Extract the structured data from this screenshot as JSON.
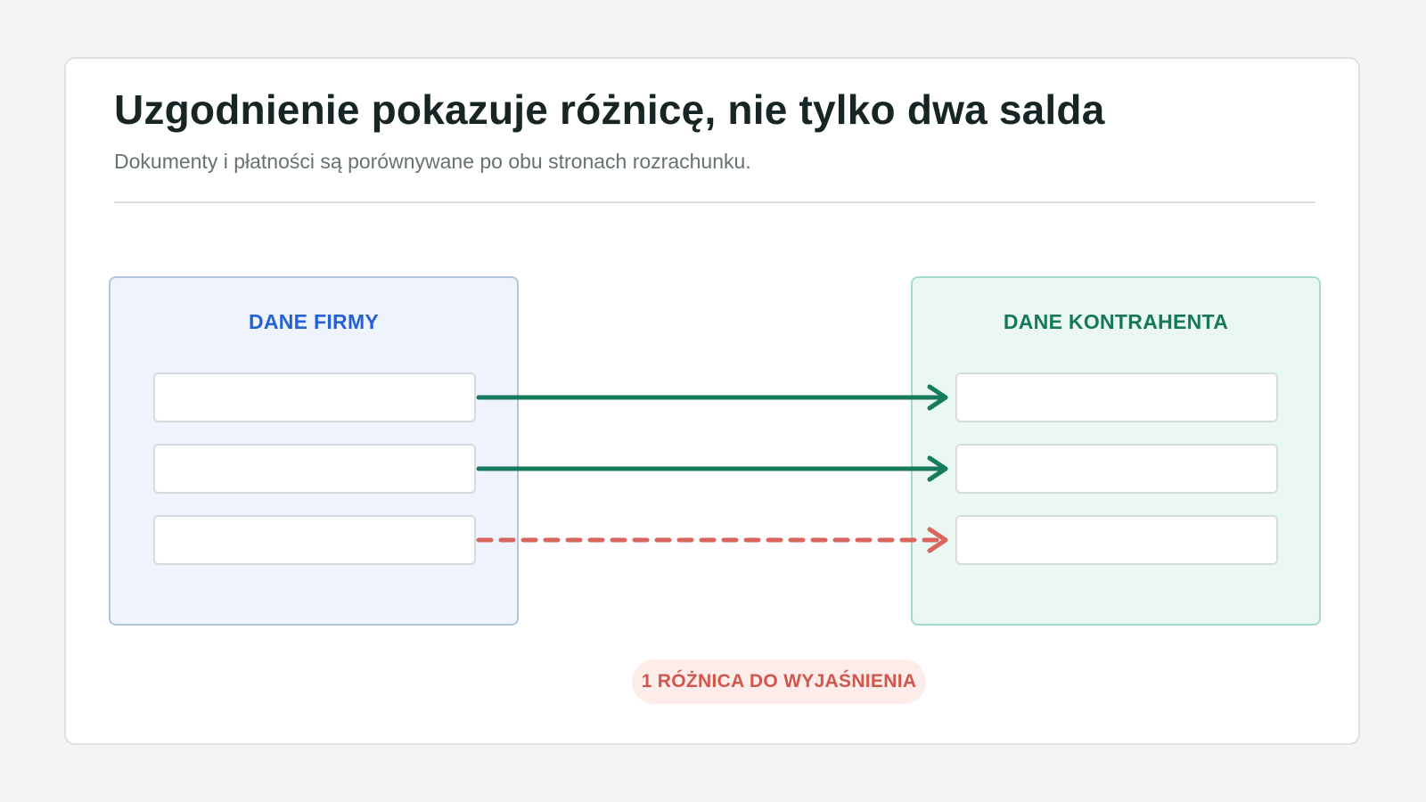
{
  "header": {
    "title": "Uzgodnienie pokazuje różnicę, nie tylko dwa salda",
    "subtitle": "Dokumenty i płatności są porównywane po obu stronach rozrachunku."
  },
  "left_panel": {
    "heading": "DANE FIRMY",
    "color": "#2461d6",
    "entries": 3
  },
  "right_panel": {
    "heading": "DANE KONTRAHENTA",
    "color": "#14795a",
    "entries": 3
  },
  "connections": [
    {
      "from": 1,
      "to": 1,
      "status": "matched",
      "style": "solid",
      "color": "#167a5c"
    },
    {
      "from": 2,
      "to": 2,
      "status": "matched",
      "style": "solid",
      "color": "#167a5c"
    },
    {
      "from": 3,
      "to": 3,
      "status": "difference",
      "style": "dashed",
      "color": "#d8665c"
    }
  ],
  "badge": {
    "label": "1 RÓŻNICA DO WYJAŚNIENIA",
    "color": "#d0574d"
  }
}
